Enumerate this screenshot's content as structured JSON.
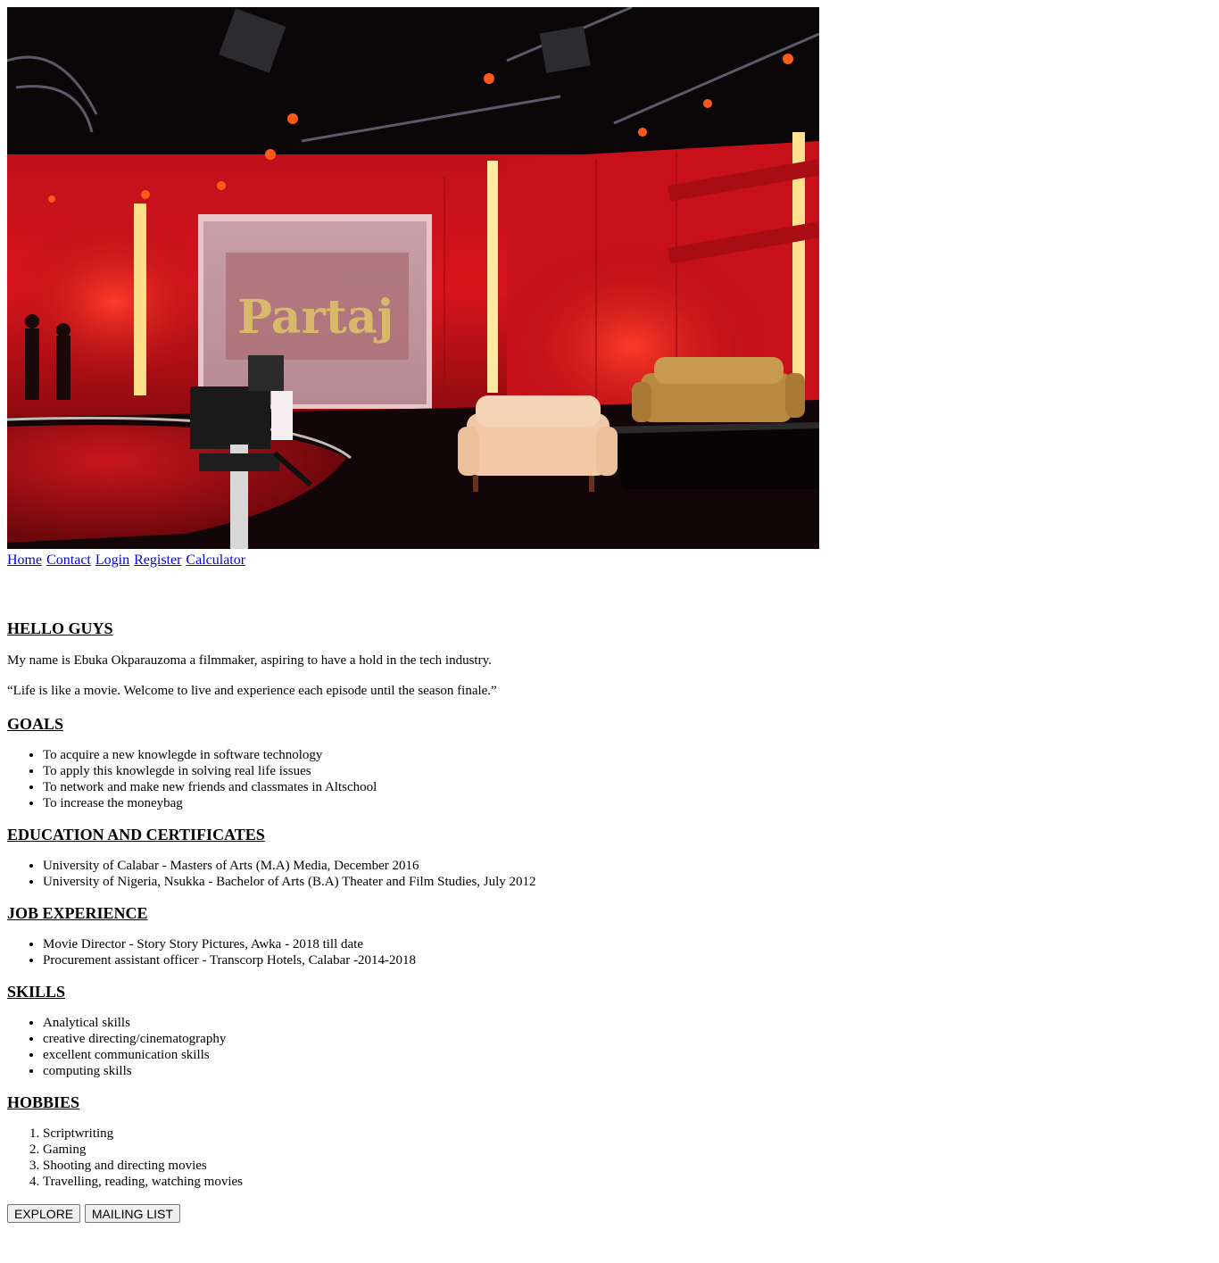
{
  "hero": {
    "screen_text": "Partaj"
  },
  "nav": [
    "Home",
    "Contact",
    "Login",
    "Register",
    "Calculator"
  ],
  "intro": {
    "heading": "HELLO GUYS",
    "bio": "My name is Ebuka Okparauzoma a filmmaker, aspiring to have a hold in the tech industry.",
    "quote": "“Life is like a movie. Welcome to live and experience each episode until the season finale.”"
  },
  "goals": {
    "heading": "GOALS",
    "items": [
      "To acquire a new knowlegde in software technology",
      "To apply this knowlegde in solving real life issues",
      "To network and make new friends and classmates in Altschool",
      "To increase the moneybag"
    ]
  },
  "education": {
    "heading": "EDUCATION AND CERTIFICATES",
    "items": [
      "University of Calabar - Masters of Arts (M.A) Media, December 2016",
      "University of Nigeria, Nsukka - Bachelor of Arts (B.A) Theater and Film Studies, July 2012"
    ]
  },
  "jobs": {
    "heading": "JOB EXPERIENCE",
    "items": [
      "Movie Director - Story Story Pictures, Awka - 2018 till date",
      "Procurement assistant officer - Transcorp Hotels, Calabar -2014-2018"
    ]
  },
  "skills": {
    "heading": "SKILLS",
    "items": [
      "Analytical skills",
      "creative directing/cinematography",
      "excellent communication skills",
      "computing skills"
    ]
  },
  "hobbies": {
    "heading": "HOBBIES",
    "items": [
      "Scriptwriting",
      "Gaming",
      "Shooting and directing movies",
      "Travelling, reading, watching movies"
    ]
  },
  "buttons": {
    "explore": "EXPLORE",
    "mailing": "MAILING LIST"
  }
}
